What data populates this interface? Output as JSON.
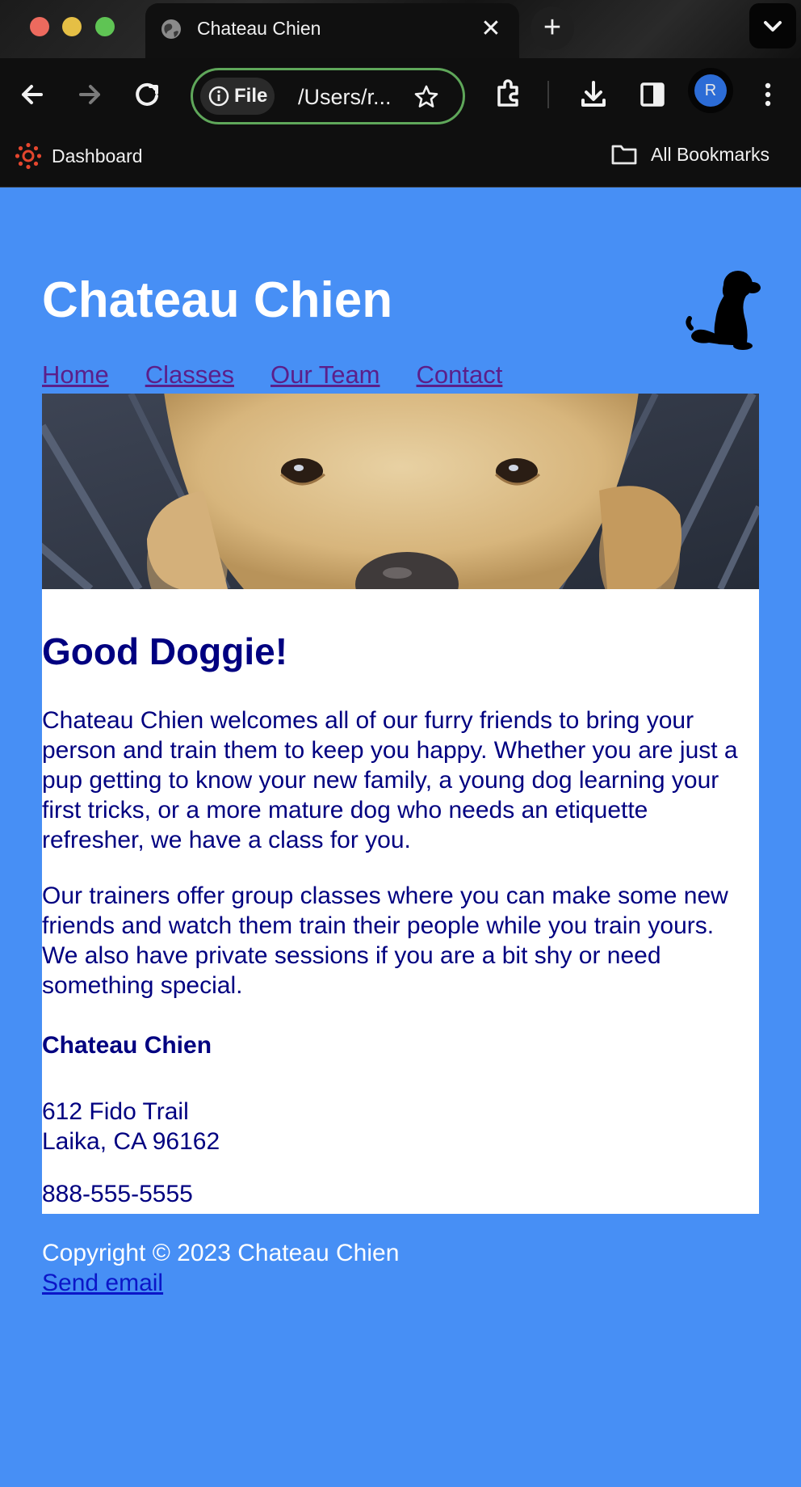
{
  "browser": {
    "tab_title": "Chateau Chien",
    "new_tab_label": "+",
    "close_tab_label": "✕",
    "omnibox": {
      "chip_label": "File",
      "url_text": "/Users/r..."
    },
    "profile_initial": "R",
    "bookmarks": {
      "dashboard_label": "Dashboard",
      "all_bookmarks_label": "All Bookmarks"
    },
    "accent_colors": {
      "omnibox_border": "#5fa75a",
      "avatar": "#2c6cd6"
    }
  },
  "site": {
    "title": "Chateau Chien",
    "nav": [
      "Home",
      "Classes",
      "Our Team",
      "Contact"
    ],
    "heading": "Good Doggie!",
    "paragraphs": [
      "Chateau Chien welcomes all of our furry friends to bring your person and train them to keep you happy. Whether you are just a pup getting to know your new family, a young dog learning your first tricks, or a more mature dog who needs an etiquette refresher, we have a class for you.",
      "Our trainers offer group classes where you can make some new friends and watch them train their people while you train yours. We also have private sessions if you are a bit shy or need something special."
    ],
    "contact": {
      "name": "Chateau Chien",
      "street": "612 Fido Trail",
      "city_line": "Laika, CA 96162",
      "phone": "888-555-5555"
    },
    "footer": {
      "copyright": "Copyright © 2023 Chateau Chien",
      "email_link": "Send email"
    },
    "colors": {
      "background": "#478ff5",
      "content_text": "#000080",
      "nav_link": "#5b1f8a",
      "email_link": "#0b16c8"
    }
  }
}
